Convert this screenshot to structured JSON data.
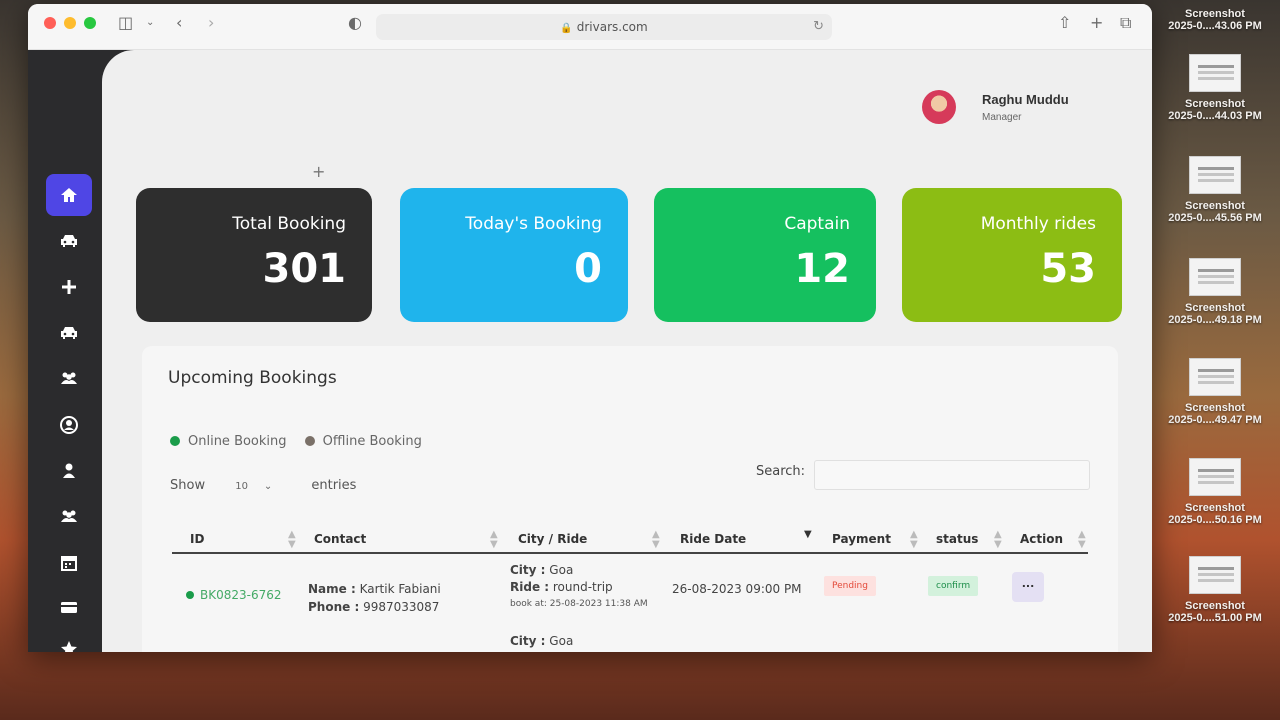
{
  "desktop": {
    "files": [
      {
        "name": "Screenshot",
        "time": "2025-0....43.06 PM"
      },
      {
        "name": "Screenshot",
        "time": "2025-0....44.03 PM"
      },
      {
        "name": "Screenshot",
        "time": "2025-0....45.56 PM"
      },
      {
        "name": "Screenshot",
        "time": "2025-0....49.18 PM"
      },
      {
        "name": "Screenshot",
        "time": "2025-0....49.47 PM"
      },
      {
        "name": "Screenshot",
        "time": "2025-0....50.16 PM"
      },
      {
        "name": "Screenshot",
        "time": "2025-0....51.00 PM"
      }
    ]
  },
  "browser": {
    "url": "drivars.com"
  },
  "user": {
    "name": "Raghu Muddu",
    "role": "Manager"
  },
  "cards": [
    {
      "title": "Total Booking",
      "value": "301",
      "color": "#2e2e2e"
    },
    {
      "title": "Today's Booking",
      "value": "0",
      "color": "#1fb4ec"
    },
    {
      "title": "Captain",
      "value": "12",
      "color": "#15c05f"
    },
    {
      "title": "Monthly rides",
      "value": "53",
      "color": "#8cbd14"
    }
  ],
  "bookings": {
    "title": "Upcoming Bookings",
    "legend": {
      "online": "Online Booking",
      "offline": "Offline Booking"
    },
    "show_label": "Show",
    "entries_value": "10",
    "entries_label": "entries",
    "search_label": "Search:",
    "columns": [
      "ID",
      "Contact",
      "City / Ride",
      "Ride Date",
      "Payment",
      "status",
      "Action"
    ],
    "rows": [
      {
        "id": "BK0823-6762",
        "name_label": "Name :",
        "name": "Kartik Fabiani",
        "phone_label": "Phone :",
        "phone": "9987033087",
        "city_label": "City :",
        "city": "Goa",
        "ride_label": "Ride :",
        "ride": "round-trip",
        "book_at": "book at: 25-08-2023 11:38 AM",
        "date": "26-08-2023 09:00 PM",
        "payment": "Pending",
        "status": "confirm",
        "action": "..."
      }
    ],
    "next_row_city_label": "City :",
    "next_row_city": "Goa"
  }
}
